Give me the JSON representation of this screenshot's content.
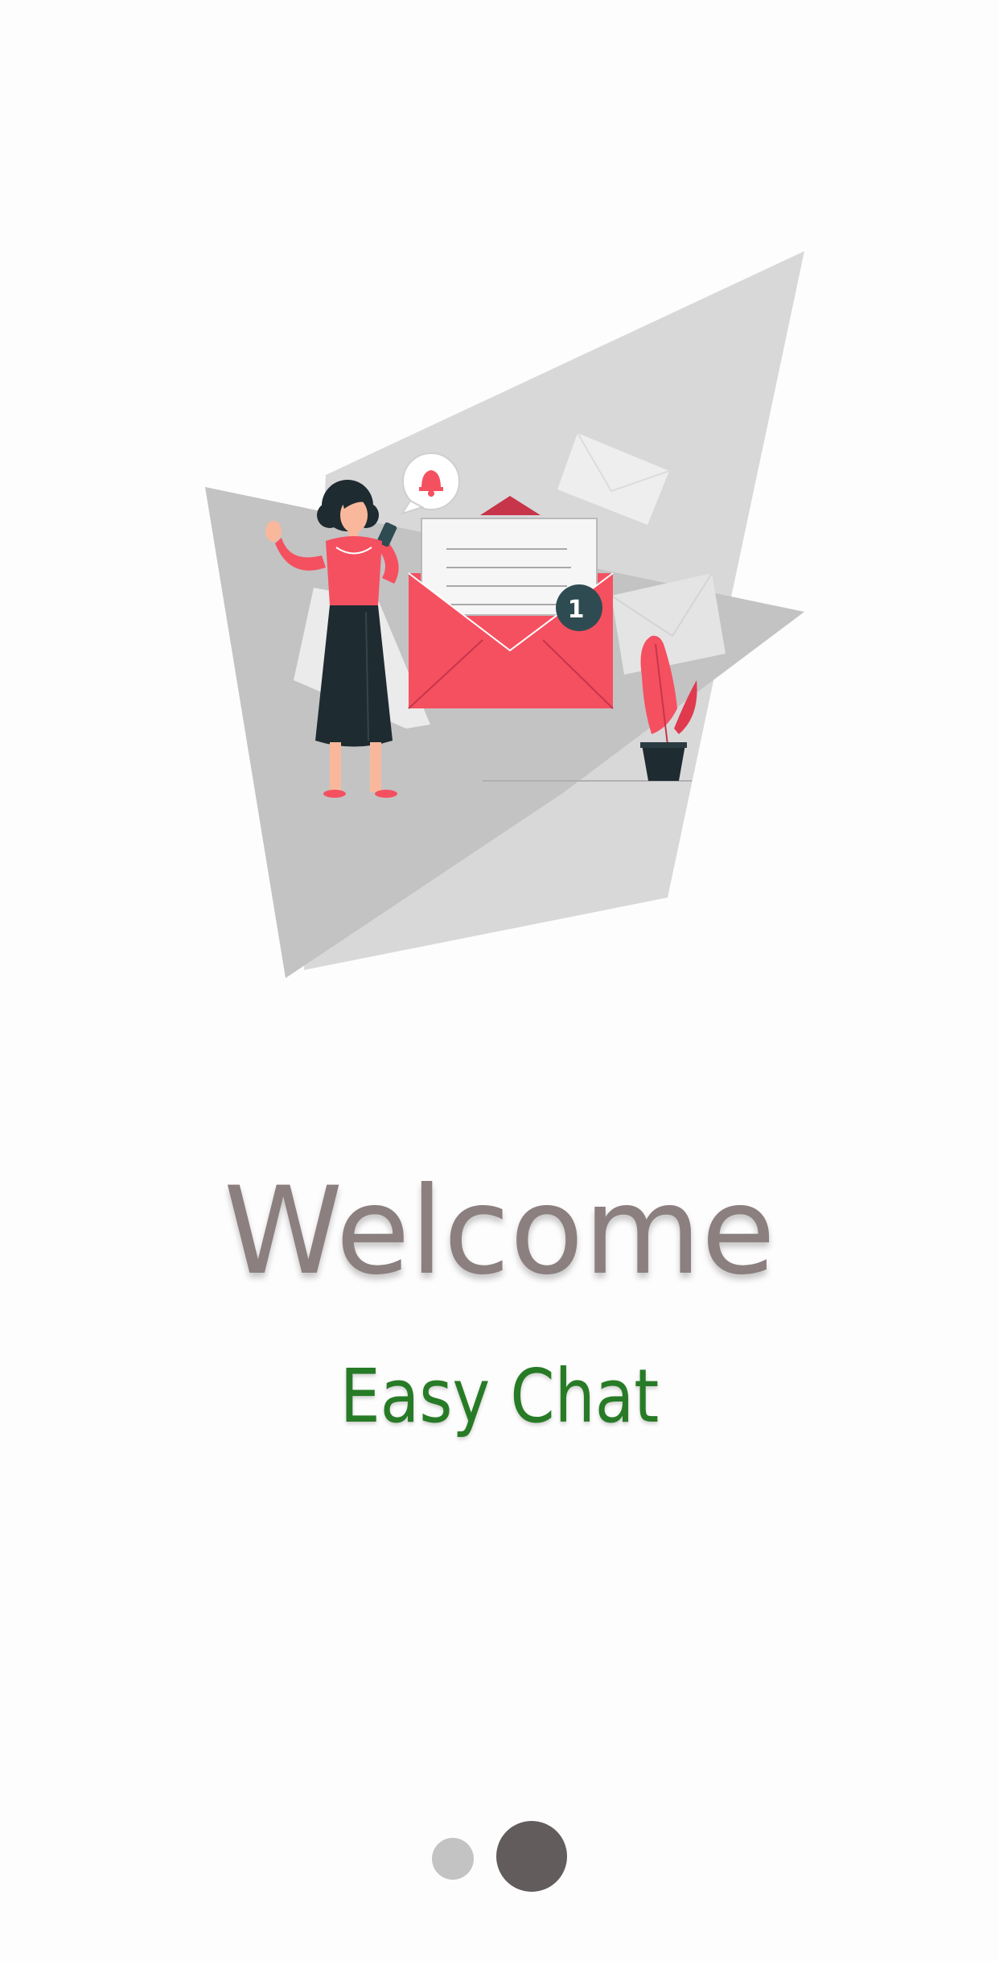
{
  "onboarding": {
    "title": "Welcome",
    "subtitle": "Easy Chat",
    "notification_count": "1",
    "pager": {
      "current_page": 2,
      "total_pages": 2
    }
  },
  "colors": {
    "background": "#fefdfd",
    "title": "#8b7f80",
    "subtitle": "#277b26",
    "accent_red": "#f55060",
    "dark": "#1e2b31",
    "dot_inactive": "#c4c3c3",
    "dot_active": "#625c5d"
  },
  "icons": [
    "envelope-icon",
    "bell-icon",
    "notification-badge",
    "plant-icon",
    "woman-figure"
  ]
}
